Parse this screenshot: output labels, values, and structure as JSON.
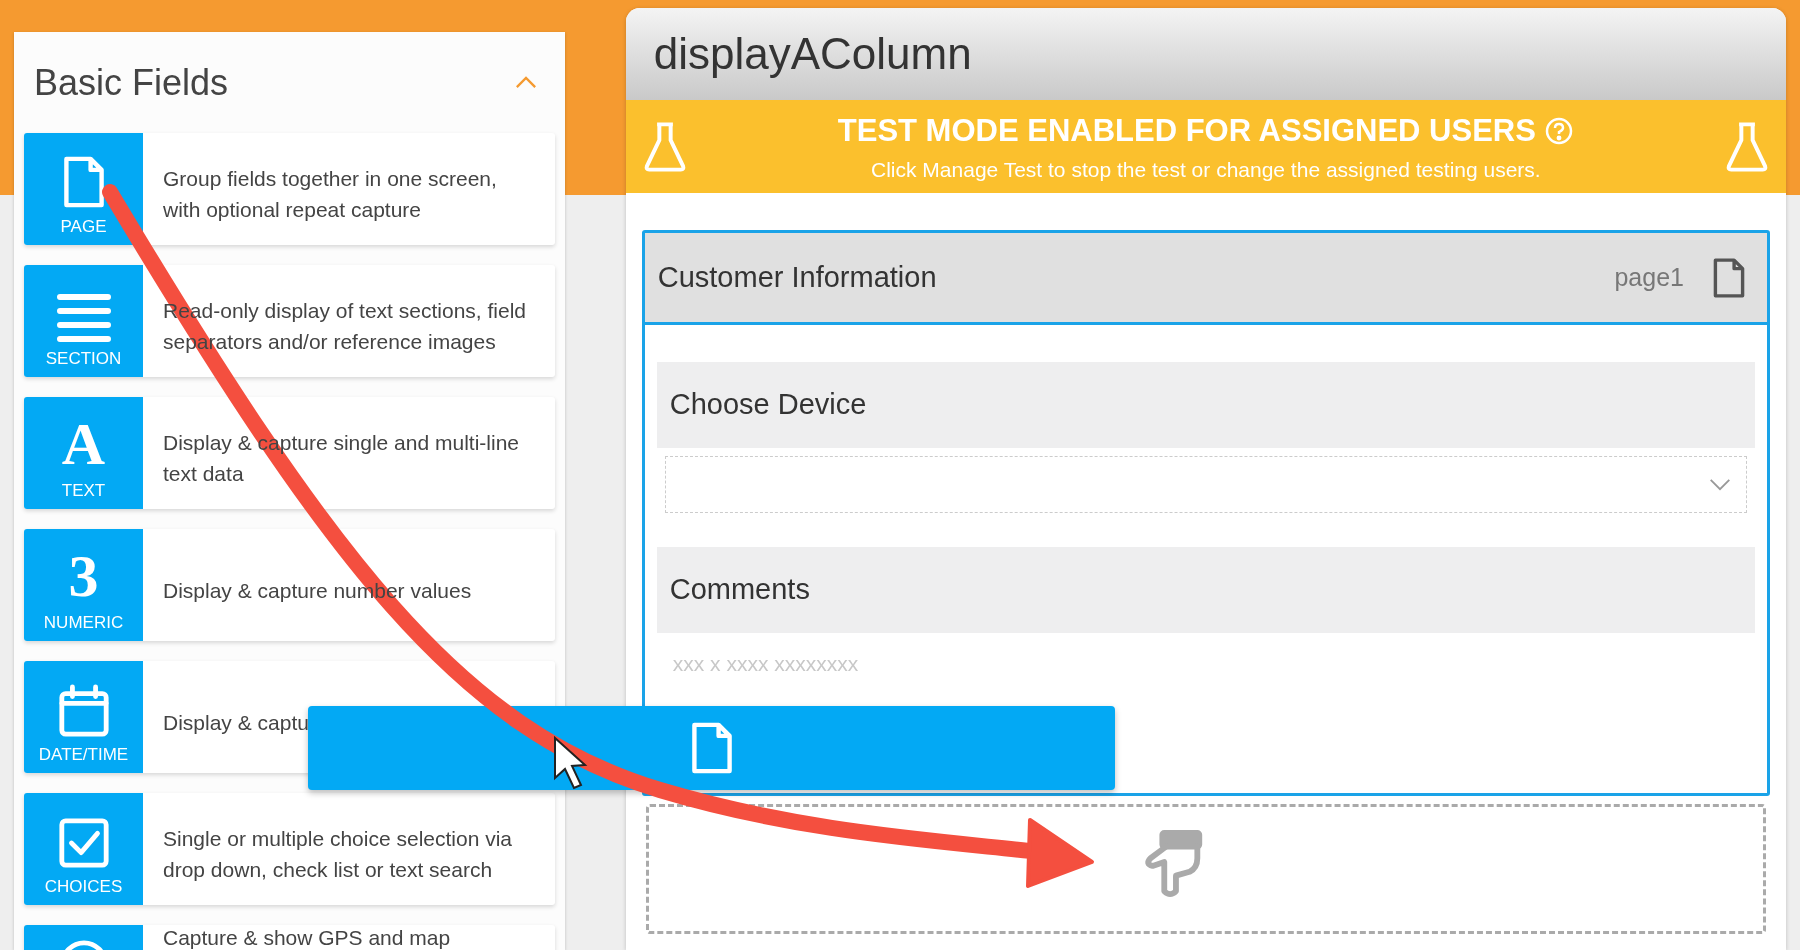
{
  "sidebar": {
    "title": "Basic Fields",
    "expanded": true,
    "fields": [
      {
        "kind": "page",
        "label": "PAGE",
        "description": "Group fields together in one screen, with optional repeat capture"
      },
      {
        "kind": "section",
        "label": "SECTION",
        "description": "Read-only display of text sections, field separators and/or reference images"
      },
      {
        "kind": "text",
        "glyph": "A",
        "label": "TEXT",
        "description": "Display & capture single and multi-line text data"
      },
      {
        "kind": "numeric",
        "glyph": "3",
        "label": "NUMERIC",
        "description": "Display & capture number values"
      },
      {
        "kind": "datetime",
        "label": "DATE/TIME",
        "description": "Display & captu"
      },
      {
        "kind": "choices",
        "label": "CHOICES",
        "description": "Single or multiple choice selection via drop down, check list or text search"
      },
      {
        "kind": "location",
        "description": "Capture & show GPS and map"
      }
    ]
  },
  "form": {
    "title": "displayAColumn",
    "banner": {
      "title": "TEST MODE ENABLED FOR ASSIGNED USERS",
      "subtitle": "Click Manage Test to stop the test or change the assigned testing users."
    },
    "page": {
      "title": "Customer Information",
      "name": "page1",
      "fields": [
        {
          "kind": "dropdown",
          "label": "Choose Device"
        },
        {
          "kind": "text",
          "label": "Comments",
          "placeholder": "xxx x xxxx xxxxxxxx"
        }
      ]
    }
  }
}
